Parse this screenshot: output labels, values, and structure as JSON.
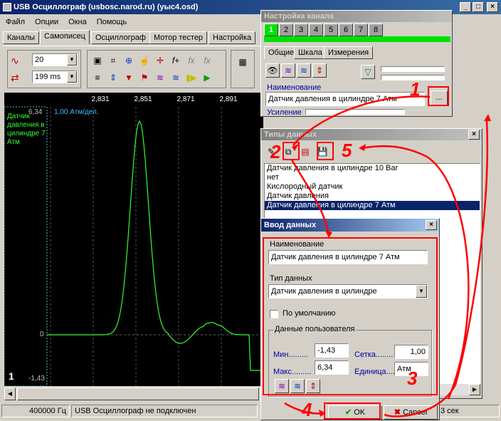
{
  "main_window": {
    "title": "USB Осциллограф (usbosc.narod.ru) (уыс4.osd)",
    "menu": [
      "Файл",
      "Опции",
      "Окна",
      "Помощь"
    ],
    "tabs": [
      "Каналы",
      "Самописец",
      "Осциллограф",
      "Мотор тестер",
      "Настройка"
    ],
    "active_tab": "Самописец",
    "toolbar": {
      "speed_value": "20",
      "time_value": "199 ms"
    },
    "chart": {
      "x_ticks": [
        "2,831",
        "2,851",
        "2,871",
        "2,891"
      ],
      "y_top_label": "6,34",
      "y_zero_label": "0",
      "y_bottom_label": "-1,43",
      "scale_label": "1,00 Атм/дел.",
      "channel_label": "Датчик давления в цилиндре 7 Атм",
      "channel_number": "1",
      "trace_color": "#30ff30"
    },
    "statusbar": {
      "frequency_value": "400000",
      "frequency_unit": "Гц",
      "status_text": "USB Осциллограф не подключен",
      "right_text": "3 сек"
    }
  },
  "channel_settings": {
    "title": "Настройка канала",
    "channel_tabs": [
      "1",
      "2",
      "3",
      "4",
      "5",
      "6",
      "7",
      "8"
    ],
    "active_channel": "1",
    "sub_tabs": [
      "Общие",
      "Шкала",
      "Измерения"
    ],
    "name_label": "Наименование",
    "name_value": "Датчик давления в цилиндре 7 Атм",
    "browse_label": "...",
    "gain_label": "Усиление"
  },
  "data_types": {
    "title": "Типы данных",
    "items": [
      "Датчик давления в цилиндре 10 Bar",
      "нет",
      "Кислородный датчик",
      "Датчик давления",
      "Датчик давления в цилиндре 7 Атм"
    ],
    "selected_index": 4
  },
  "data_entry": {
    "title": "Ввод данных",
    "name_label": "Наименование",
    "name_value": "Датчик давления в цилиндре 7 Атм",
    "type_label": "Тип данных",
    "type_value": "Датчик давления в цилиндре",
    "default_label": "По умолчанию",
    "default_checked": false,
    "user_data_label": "Данные пользователя",
    "min_label": "Мин.........",
    "min_value": "-1,43",
    "max_label": "Макс.........",
    "max_value": "6,34",
    "grid_label": "Сетка........",
    "grid_value": "1,00",
    "unit_label": "Единица.....",
    "unit_value": "Атм",
    "ok_label": "OK",
    "cancel_label": "Cancel"
  },
  "annotations": {
    "numbers": [
      "1",
      "2",
      "3",
      "4",
      "5"
    ],
    "color": "#ff0000"
  }
}
